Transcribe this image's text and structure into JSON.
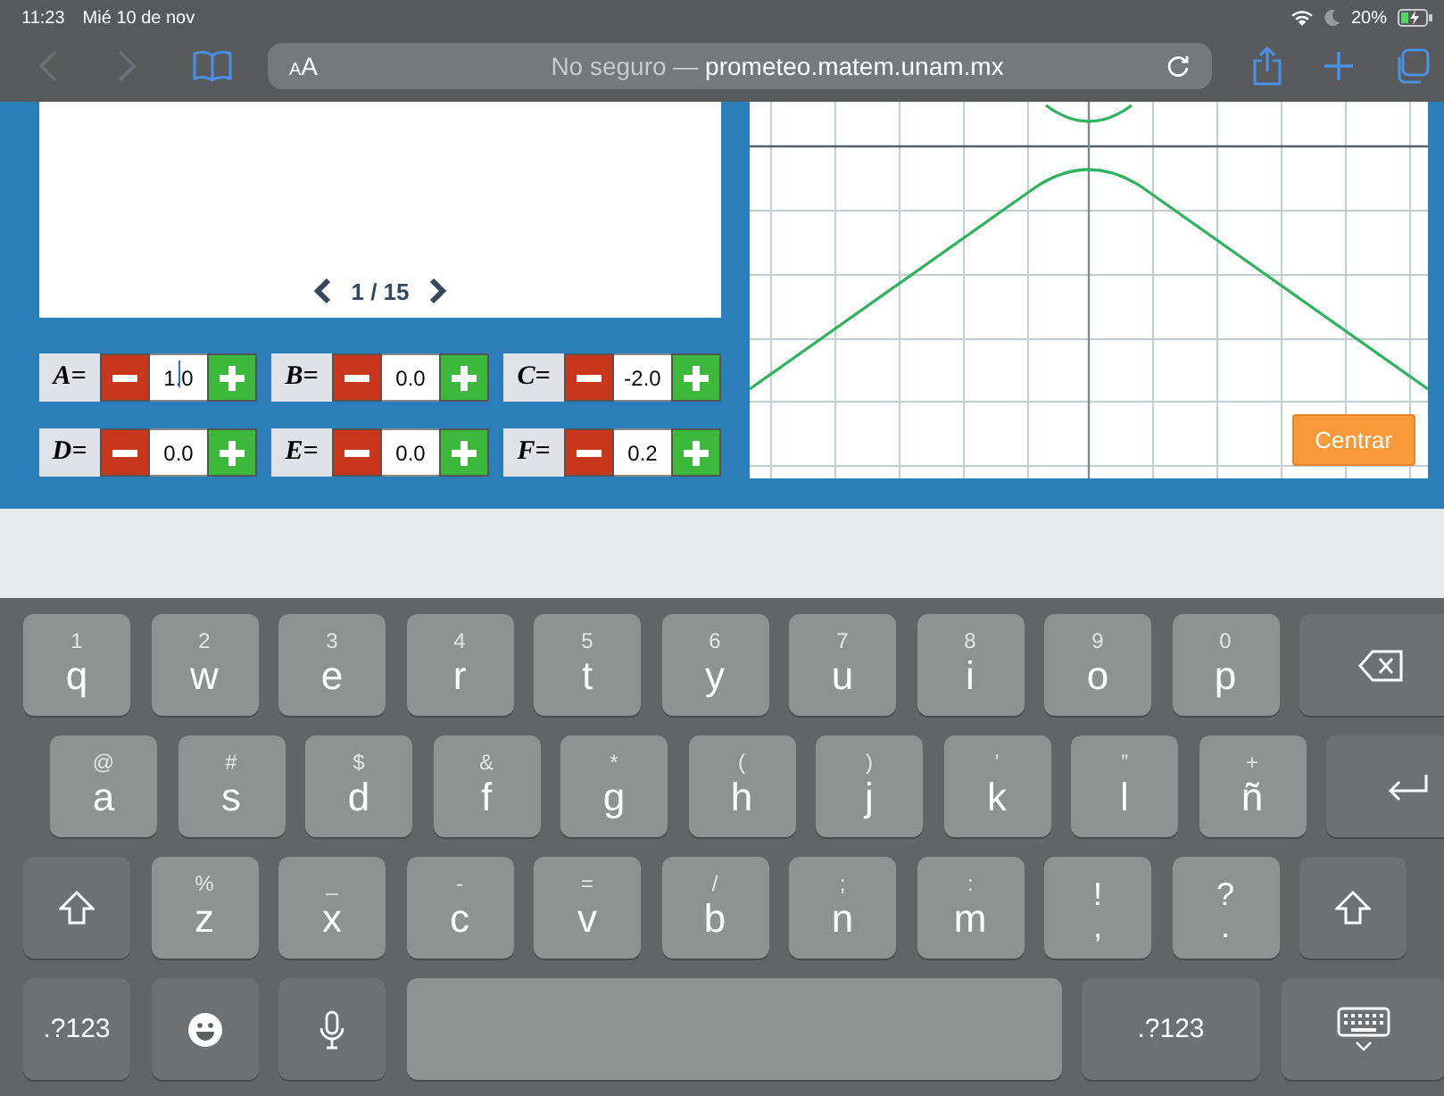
{
  "status_bar": {
    "time": "11:23",
    "date": "Mié 10 de nov",
    "battery": "20%"
  },
  "browser_toolbar": {
    "text_size_button": "AA",
    "address": {
      "prefix": "No seguro —",
      "url": "prometeo.matem.unam.mx"
    }
  },
  "pager": {
    "label": "1 / 15"
  },
  "parameters": [
    {
      "label": "A=",
      "value": "1.0",
      "focused": true
    },
    {
      "label": "B=",
      "value": "0.0",
      "focused": false
    },
    {
      "label": "C=",
      "value": "-2.0",
      "focused": false
    },
    {
      "label": "D=",
      "value": "0.0",
      "focused": false
    },
    {
      "label": "E=",
      "value": "0.0",
      "focused": false
    },
    {
      "label": "F=",
      "value": "0.2",
      "focused": false
    }
  ],
  "graph": {
    "button": "Centrar"
  },
  "keyboard": {
    "rows": [
      [
        {
          "kind": "letter",
          "main": "q",
          "alt": "1"
        },
        {
          "kind": "letter",
          "main": "w",
          "alt": "2"
        },
        {
          "kind": "letter",
          "main": "e",
          "alt": "3"
        },
        {
          "kind": "letter",
          "main": "r",
          "alt": "4"
        },
        {
          "kind": "letter",
          "main": "t",
          "alt": "5"
        },
        {
          "kind": "letter",
          "main": "y",
          "alt": "6"
        },
        {
          "kind": "letter",
          "main": "u",
          "alt": "7"
        },
        {
          "kind": "letter",
          "main": "i",
          "alt": "8"
        },
        {
          "kind": "letter",
          "main": "o",
          "alt": "9"
        },
        {
          "kind": "letter",
          "main": "p",
          "alt": "0"
        },
        {
          "kind": "backspace"
        }
      ],
      [
        {
          "kind": "letter",
          "main": "a",
          "alt": "@"
        },
        {
          "kind": "letter",
          "main": "s",
          "alt": "#"
        },
        {
          "kind": "letter",
          "main": "d",
          "alt": "$"
        },
        {
          "kind": "letter",
          "main": "f",
          "alt": "&"
        },
        {
          "kind": "letter",
          "main": "g",
          "alt": "*"
        },
        {
          "kind": "letter",
          "main": "h",
          "alt": "("
        },
        {
          "kind": "letter",
          "main": "j",
          "alt": ")"
        },
        {
          "kind": "letter",
          "main": "k",
          "alt": "’"
        },
        {
          "kind": "letter",
          "main": "l",
          "alt": "”"
        },
        {
          "kind": "letter",
          "main": "ñ",
          "alt": "+"
        },
        {
          "kind": "return"
        }
      ],
      [
        {
          "kind": "shift"
        },
        {
          "kind": "letter",
          "main": "z",
          "alt": "%"
        },
        {
          "kind": "letter",
          "main": "x",
          "alt": "_"
        },
        {
          "kind": "letter",
          "main": "c",
          "alt": "-"
        },
        {
          "kind": "letter",
          "main": "v",
          "alt": "="
        },
        {
          "kind": "letter",
          "main": "b",
          "alt": "/"
        },
        {
          "kind": "letter",
          "main": "n",
          "alt": ";"
        },
        {
          "kind": "letter",
          "main": "m",
          "alt": ":"
        },
        {
          "kind": "dual",
          "main": ",",
          "alt": "!"
        },
        {
          "kind": "dual",
          "main": ".",
          "alt": "?"
        },
        {
          "kind": "shift"
        }
      ],
      [
        {
          "kind": "mode",
          "main": ".?123"
        },
        {
          "kind": "emoji"
        },
        {
          "kind": "mic"
        },
        {
          "kind": "space"
        },
        {
          "kind": "mode",
          "main": ".?123"
        },
        {
          "kind": "hide"
        }
      ]
    ]
  }
}
